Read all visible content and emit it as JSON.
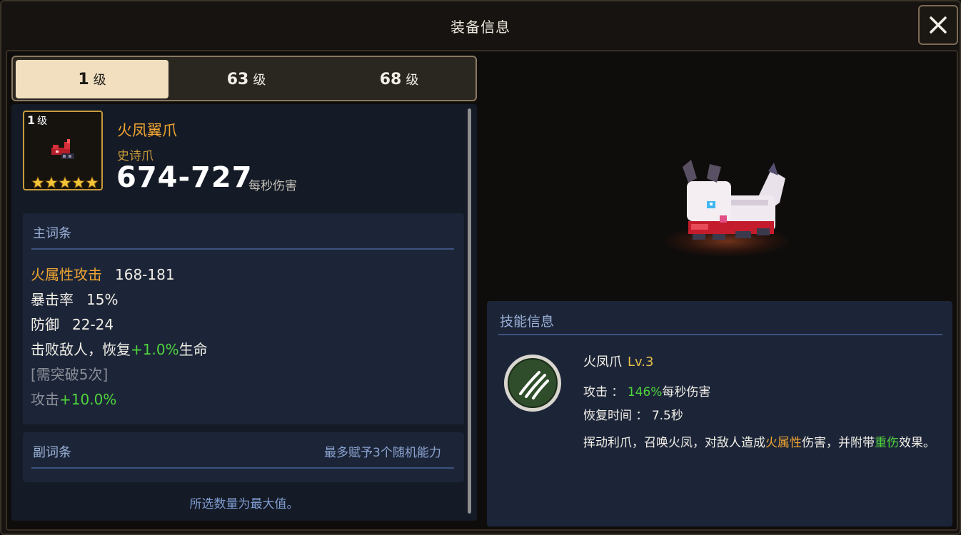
{
  "window": {
    "title": "装备信息",
    "close_icon": "close-icon"
  },
  "tabs": [
    {
      "level": "1",
      "unit": "级",
      "active": true
    },
    {
      "level": "63",
      "unit": "级",
      "active": false
    },
    {
      "level": "68",
      "unit": "级",
      "active": false
    }
  ],
  "item": {
    "icon_level": "1",
    "icon_level_unit": "级",
    "stars": 5,
    "name": "火凤翼爪",
    "type": "史诗爪",
    "dps": "674-727",
    "dps_label": "每秒伤害"
  },
  "main_stats": {
    "title": "主词条",
    "rows": [
      {
        "label": "火属性攻击",
        "value": "168-181"
      },
      {
        "label": "暴击率",
        "value": "15%"
      },
      {
        "label": "防御",
        "value": "22-24"
      }
    ],
    "effect": {
      "prefix": "击败敌人，恢复",
      "highlight": "+1.0%",
      "suffix": "生命"
    },
    "locked_note": "[需突破5次]",
    "locked_stat": {
      "label": "攻击",
      "value": "+10.0%"
    }
  },
  "sub_stats": {
    "title": "副词条",
    "note": "最多赋予3个随机能力"
  },
  "footer_note": "所选数量为最大值。",
  "skill": {
    "panel_title": "技能信息",
    "icon": "claw-slash-icon",
    "name": "火凤爪",
    "level": "Lv.3",
    "attack_label": "攻击 ：",
    "attack_value": "146%",
    "attack_suffix": "每秒伤害",
    "cooldown_label": "恢复时间 ：",
    "cooldown_value": "7.5秒",
    "desc_part1": "挥动利爪，召唤火凤，对敌人造成",
    "desc_highlight1": "火属性",
    "desc_part2": "伤害，并附带",
    "desc_highlight2": "重伤",
    "desc_part3": "效果。"
  },
  "colors": {
    "accent_orange": "#f0a531",
    "positive_green": "#4fd43d",
    "panel_blue": "#1c2538",
    "tab_active": "#f1dfbf"
  }
}
